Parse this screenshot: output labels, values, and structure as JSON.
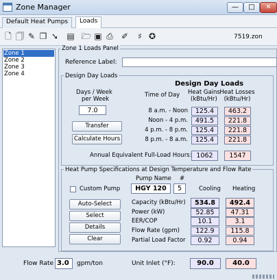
{
  "window": {
    "title": "Zone Manager",
    "min_glyph": "—",
    "max_glyph": "□",
    "close_glyph": "✕"
  },
  "tabs": [
    {
      "label": "Default Heat Pumps",
      "active": false
    },
    {
      "label": "Loads",
      "active": true
    }
  ],
  "toolbar": {
    "icons": [
      "new-doc-icon",
      "copy-doc-icon",
      "edit-doc-icon",
      "stack-doc-icon",
      "arrow-doc-icon",
      "print-preview-icon",
      "open-folder-icon",
      "save-icon",
      "print-icon",
      "pen-icon",
      "hash-icon",
      "cert-icon"
    ],
    "filename": "7519.zon"
  },
  "zones": [
    "Zone 1",
    "Zone 2",
    "Zone 3",
    "Zone 4"
  ],
  "selected_zone": "Zone 1",
  "panel": {
    "title": "Zone 1 Loads Panel",
    "reference_label": "Reference Label:",
    "reference_value": ""
  },
  "design_day": {
    "legend": "Design Day Loads",
    "heading": "Design Day Loads",
    "days_label_1": "Days / Week",
    "days_label_2": "per Week",
    "days_value": "7.0",
    "col_time": "Time of Day",
    "col_gains_1": "Heat Gains",
    "col_gains_2": "(kBtu/Hr)",
    "col_losses_1": "Heat Losses",
    "col_losses_2": "(kBtu/Hr)",
    "rows": [
      {
        "time": "8 a.m. - Noon",
        "gain": "125.4",
        "loss": "463.2"
      },
      {
        "time": "Noon - 4 p.m.",
        "gain": "491.5",
        "loss": "221.8"
      },
      {
        "time": "4 p.m. - 8 p.m.",
        "gain": "125.4",
        "loss": "221.8"
      },
      {
        "time": "8 p.m. - 8 a.m.",
        "gain": "125.4",
        "loss": "221.8"
      }
    ],
    "transfer_label": "Transfer",
    "calc_label": "Calculate Hours",
    "annual_label": "Annual Equivalent Full-Load Hours:",
    "annual_cool": "1062",
    "annual_heat": "1547"
  },
  "heat_pump": {
    "legend": "Heat Pump Specifications at Design Temperature and Flow Rate",
    "pump_name_label": "Pump Name",
    "count_label": "#",
    "custom_label": "Custom Pump",
    "custom_checked": false,
    "pump_name": "HGY 120",
    "pump_count": "5",
    "cooling_label": "Cooling",
    "heating_label": "Heating",
    "auto_select": "Auto-Select",
    "select": "Select",
    "details": "Details",
    "clear": "Clear",
    "specs": [
      {
        "label": "Capacity (kBtu/Hr)",
        "cool": "534.8",
        "heat": "492.4",
        "bold": true
      },
      {
        "label": "Power (kW)",
        "cool": "52.85",
        "heat": "47.31",
        "bold": false
      },
      {
        "label": "EER/COP",
        "cool": "10.1",
        "heat": "3.1",
        "bold": false
      },
      {
        "label": "Flow Rate (gpm)",
        "cool": "122.9",
        "heat": "115.8",
        "bold": false
      },
      {
        "label": "Partial Load Factor",
        "cool": "0.92",
        "heat": "0.94",
        "bold": false
      }
    ]
  },
  "bottom": {
    "flow_rate_label": "Flow Rate",
    "flow_rate_value": "3.0",
    "flow_rate_unit": "gpm/ton",
    "unit_inlet_label": "Unit Inlet (°F):",
    "unit_inlet_cool": "90.0",
    "unit_inlet_heat": "40.0"
  },
  "colors": {
    "cool_fill": "#e8e6fb",
    "heat_fill": "#fde1e1",
    "selection": "#2f6fc6"
  }
}
